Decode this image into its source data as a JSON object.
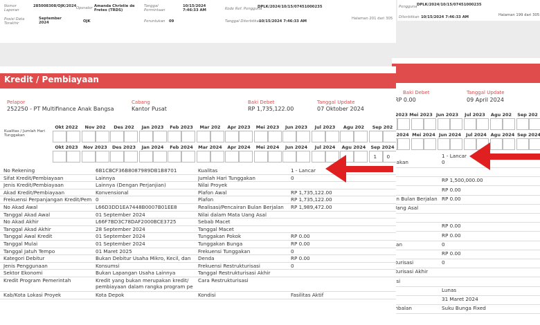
{
  "header": {
    "nomor_laporan_label": "Nomor Laporan",
    "nomor_laporan_value": "285008308/OJK/2024",
    "operator_label": "Operator",
    "operator_value": "Amanda Christie de Fretes (TRDS)",
    "tanggal_permintaan_label": "Tanggal Permintaan",
    "tanggal_permintaan_value": "10/15/2024 7:46:33 AM",
    "kode_ref_label": "Kode Ref. Pengguna",
    "kode_ref_value": "DPLK/2024/10/15/07451000235",
    "posisi_data_label": "Posisi Data Terakhir",
    "posisi_data_value": "September 2024",
    "ojk_value": "OJK",
    "peruntukan_label": "Peruntukan",
    "peruntukan_value": "09",
    "tanggal_diterbitkan_label": "Tanggal Diterbitkan",
    "tanggal_diterbitkan_value": "10/15/2024 7:46:33 AM",
    "halaman": "Halaman 201 dari 305"
  },
  "header2": {
    "pengguna_label": "Pengguna",
    "pengguna_value": "DPLK/2024/10/15/07451000235",
    "diterbitkan_label": "Diterbitkan",
    "diterbitkan_value": "10/15/2024 7:46:33 AM",
    "halaman": "Halaman 199 dari 305"
  },
  "main": {
    "title": "Kredit / Pembiayaan",
    "pelapor_label": "Pelapor",
    "pelapor_value": "252250 - PT Multifinance Anak Bangsa",
    "cabang_label": "Cabang",
    "cabang_value": "Kantor Pusat",
    "baki_label": "Baki Debet",
    "baki_value": "RP 1,735,122.00",
    "tgl_update_label": "Tanggal Update",
    "tgl_update_value": "07 Oktober 2024",
    "kualitas_label": "Kualitas / Jumlah Hari Tunggakan",
    "months_row1": [
      "Okt 2022",
      "Nov 202",
      "Des 202",
      "Jan 2023",
      "Feb 2023",
      "Mar 202",
      "Apr 2023",
      "Mei 2023",
      "Jun 2023",
      "Jul 2023",
      "Agu 202",
      "Sep 202"
    ],
    "months_row2": [
      "Okt 2023",
      "Nov 2023",
      "Des 2023",
      "Jan 2024",
      "Feb 2024",
      "Mar 2024",
      "Apr 2024",
      "Mei 2024",
      "Jun 2024",
      "Jul 2024",
      "Agu 2024",
      "Sep 2024"
    ],
    "last_box_values": [
      "1",
      "0"
    ],
    "left_rows": [
      [
        "No Rekening",
        "6B1CBCF36B8087989DB1B8701"
      ],
      [
        "Sifat Kredit/Pembiayaan",
        "Lainnya"
      ],
      [
        "Jenis Kredit/Pembiayaan",
        "Lainnya (Dengan Perjanjian)"
      ],
      [
        "Akad Kredit/Pembiayaan",
        "Konvensional"
      ],
      [
        "Frekuensi Perpanjangan Kredit/Pem",
        "0"
      ],
      [
        "No Akad Awal",
        "L66D3DD1EA7448B0007B01EE8"
      ],
      [
        "Tanggal Akad Awal",
        "01 September 2024"
      ],
      [
        "No Akad Akhir",
        "L66F7BD3C78DAF2000BCE3725"
      ],
      [
        "Tanggal Akad Akhir",
        "28 September 2024"
      ],
      [
        "Tanggal Awal Kredit",
        "01 September 2024"
      ],
      [
        "Tanggal Mulai",
        "01 September 2024"
      ],
      [
        "Tanggal Jatuh Tempo",
        "01 Maret 2025"
      ],
      [
        "Kategori Debitur",
        "Bukan Debitur Usaha Mikro, Kecil, dan"
      ],
      [
        "Jenis Penggunaan",
        "Konsumsi"
      ],
      [
        "Sektor Ekonomi",
        "Bukan Lapangan Usaha Lainnya"
      ],
      [
        "Kredit Program Pemerintah",
        "Kredit yang bukan merupakan kredit/ pembiayaan dalam rangka program pe"
      ],
      [
        "Kab/Kota Lokasi Proyek",
        "Kota Depok"
      ]
    ],
    "right_rows": [
      [
        "Kualitas",
        "1 - Lancar"
      ],
      [
        "Jumlah Hari Tunggakan",
        "0"
      ],
      [
        "Nilai Proyek",
        ""
      ],
      [
        "Plafon Awal",
        "RP 1,735,122.00"
      ],
      [
        "Plafon",
        "RP 1,735,122.00"
      ],
      [
        "Realisasi/Pencairan Bulan Berjalan",
        "RP 1,989,472.00"
      ],
      [
        "Nilai dalam Mata Uang Asal",
        ""
      ],
      [
        "Sebab Macet",
        ""
      ],
      [
        "Tanggal Macet",
        ""
      ],
      [
        "Tunggakan Pokok",
        "RP 0.00"
      ],
      [
        "Tunggakan Bunga",
        "RP 0.00"
      ],
      [
        "Frekuensi Tunggakan",
        "0"
      ],
      [
        "Denda",
        "RP 0.00"
      ],
      [
        "Frekuensi Restrukturisasi",
        "0"
      ],
      [
        "Tanggal Restrukturisasi Akhir",
        ""
      ],
      [
        "Cara Restrukturisasi",
        ""
      ],
      [
        "Kondisi",
        "Fasilitas Aktif"
      ]
    ]
  },
  "right_page": {
    "baki_label": "Baki Debet",
    "baki_value": "RP 0.00",
    "tgl_update_label": "Tanggal Update",
    "tgl_update_value": "09 April 2024",
    "months_row1": [
      "Jun 2023",
      "Jul 2023",
      "Agu 202",
      "Sep 202"
    ],
    "months_row1_left": [
      "Apr 2023",
      "Mei 2023"
    ],
    "months_row2": [
      "Apr 2024",
      "Mei 2024",
      "Jun 2024",
      "Jul 2024",
      "Agu 2024",
      "Sep 2024"
    ],
    "months_row0_left": [
      "2023",
      "Mei 2023"
    ],
    "kualitas_value": "1 - Lancar",
    "rows": [
      [
        "gakan",
        "0"
      ],
      [
        "",
        ""
      ],
      [
        "",
        "RP 1,500,000.00"
      ],
      [
        "",
        "RP 0.00"
      ],
      [
        "an Bulan Berjalan",
        "RP 0.00"
      ],
      [
        "Uang Asal",
        ""
      ],
      [
        "",
        ""
      ],
      [
        "k",
        "RP 0.00"
      ],
      [
        "a",
        "RP 0.00"
      ],
      [
        "kan",
        "0"
      ],
      [
        "",
        "RP 0.00"
      ],
      [
        "rturisasi",
        "0"
      ],
      [
        "rturisasi Akhir",
        ""
      ],
      [
        "asi",
        ""
      ],
      [
        "",
        "Lunas"
      ],
      [
        "",
        "31 Maret 2024"
      ],
      [
        "mbalan",
        "Suku Bunga Fixed"
      ]
    ]
  },
  "colors": {
    "accent": "#e04b4b",
    "arrow": "#e02020"
  }
}
